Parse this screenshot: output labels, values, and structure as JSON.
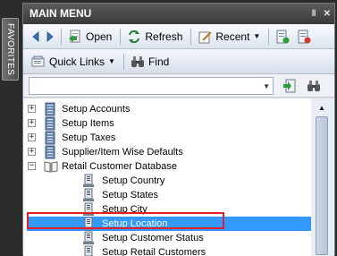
{
  "favorites_tab": {
    "label": "FAVORITES"
  },
  "window": {
    "title": "MAIN MENU",
    "pin_glyph": "‖",
    "close_glyph": "✕"
  },
  "toolbar1": {
    "open_label": "Open",
    "refresh_label": "Refresh",
    "recent_label": "Recent"
  },
  "toolbar2": {
    "quick_links_label": "Quick Links",
    "find_label": "Find"
  },
  "search": {
    "value": ""
  },
  "tree": {
    "items": [
      {
        "label": "Setup Accounts",
        "level": 0,
        "expander": "+",
        "icon": "ledger-icon"
      },
      {
        "label": "Setup Items",
        "level": 0,
        "expander": "+",
        "icon": "ledger-icon"
      },
      {
        "label": "Setup Taxes",
        "level": 0,
        "expander": "+",
        "icon": "ledger-icon"
      },
      {
        "label": "Supplier/Item Wise Defaults",
        "level": 0,
        "expander": "+",
        "icon": "ledger-icon"
      },
      {
        "label": "Retail Customer Database",
        "level": 0,
        "expander": "−",
        "icon": "open-book-icon"
      },
      {
        "label": "Setup Country",
        "level": 1,
        "icon": "form-icon"
      },
      {
        "label": "Setup States",
        "level": 1,
        "icon": "form-icon"
      },
      {
        "label": "Setup City",
        "level": 1,
        "icon": "form-icon"
      },
      {
        "label": "Setup Location",
        "level": 1,
        "icon": "form-icon",
        "selected": true
      },
      {
        "label": "Setup Customer Status",
        "level": 1,
        "icon": "form-icon"
      },
      {
        "label": "Setup Retail Customers",
        "level": 1,
        "icon": "form-icon"
      }
    ]
  },
  "colors": {
    "title_bar": "#4a4a4a",
    "selection": "#3399ff",
    "highlight_outline": "#e0202a",
    "toolbar": "#dce4ef"
  }
}
